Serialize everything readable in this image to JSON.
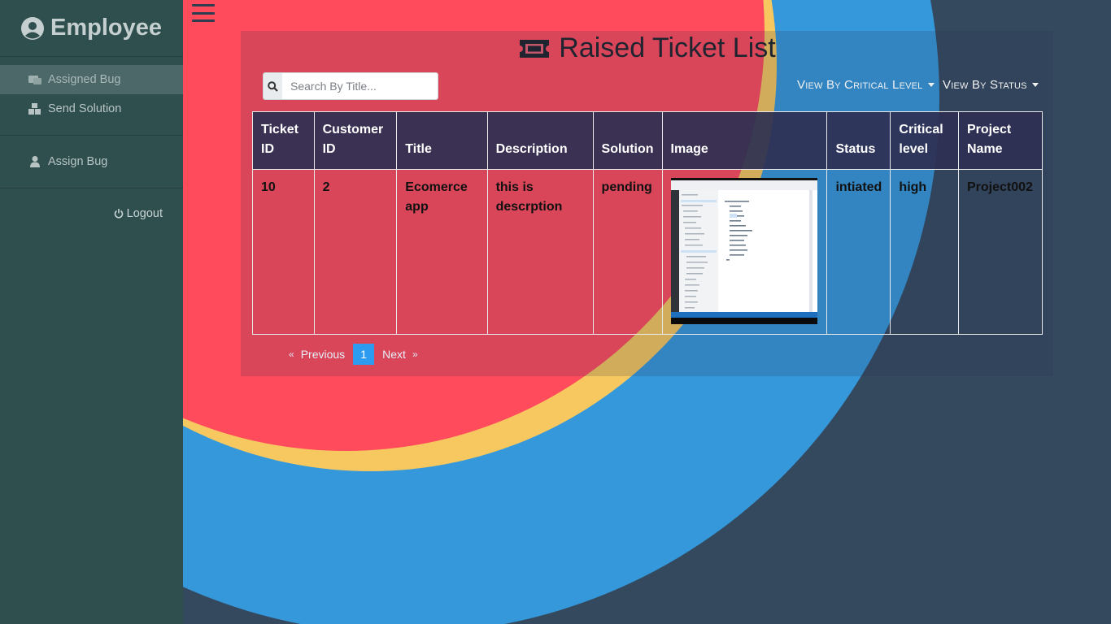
{
  "sidebar": {
    "brand": "Employee",
    "items": [
      {
        "label": "Assigned Bug",
        "icon": "bug-ticket-icon",
        "active": true
      },
      {
        "label": "Send Solution",
        "icon": "cubes-icon",
        "active": false
      }
    ],
    "items2": [
      {
        "label": "Assign Bug",
        "icon": "user-icon"
      }
    ],
    "logout": "Logout"
  },
  "main": {
    "title": "Raised Ticket List",
    "search_placeholder": "Search By Title...",
    "filter_critical": "View By Critical Level",
    "filter_status": "View By Status",
    "table": {
      "headers": [
        "Ticket ID",
        "Customer ID",
        "Title",
        "Description",
        "Solution",
        "Image",
        "Status",
        "Critical level",
        "Project Name"
      ],
      "rows": [
        {
          "ticket_id": "10",
          "customer_id": "2",
          "title": "Ecomerce app",
          "description": "this is descrption",
          "solution": "pending",
          "status": "intiated",
          "critical": "high",
          "project": "Project002"
        }
      ]
    },
    "pagination": {
      "prev": "Previous",
      "page": "1",
      "next": "Next",
      "prev_arrow": "«",
      "next_arrow": "»"
    }
  },
  "colors": {
    "sidebar": "#2f4f4f",
    "background": "#34495e",
    "accent_red": "#ff4b5c",
    "accent_yellow": "#f6c85f",
    "accent_blue": "#3498db",
    "page_active": "#2d9bf0"
  }
}
